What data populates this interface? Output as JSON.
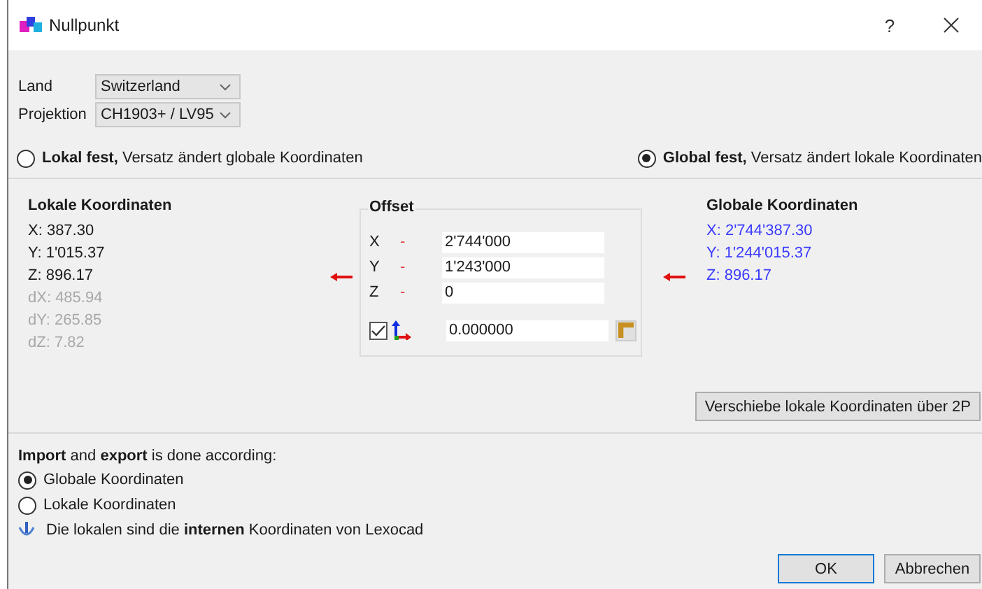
{
  "window": {
    "title": "Nullpunkt",
    "help": "?"
  },
  "land": {
    "label": "Land",
    "value": "Switzerland"
  },
  "projection": {
    "label": "Projektion",
    "value": "CH1903+ / LV95"
  },
  "mode_options": [
    {
      "label": "**Lokal fest,** Versatz ändert globale Koordinaten",
      "selected": false
    },
    {
      "label": "**Global fest,** Versatz ändert lokale Koordinaten",
      "selected": true
    }
  ],
  "local": {
    "title": "Lokale Koordinaten",
    "values": [
      "X: 387.30",
      "Y: 1'015.37",
      "Z: 896.17"
    ],
    "deltas": [
      "dX: 485.94",
      "dY: 265.85",
      "dZ: 7.82"
    ]
  },
  "offset": {
    "title": "Offset",
    "rows": [
      {
        "axis": "X",
        "sign": "-",
        "value": "2'744'000"
      },
      {
        "axis": "Y",
        "sign": "-",
        "value": "1'243'000"
      },
      {
        "axis": "Z",
        "sign": "-",
        "value": "0"
      }
    ],
    "rotation": {
      "checked": true,
      "value": "0.000000"
    }
  },
  "global": {
    "title": "Globale Koordinaten",
    "values": [
      "X: 2'744'387.30",
      "Y: 1'244'015.37",
      "Z: 896.17"
    ]
  },
  "shift_button": "Verschiebe lokale Koordinaten über 2P",
  "io": {
    "text": "**Import** and **export** is done according:",
    "options": [
      {
        "label": "Globale Koordinaten",
        "selected": true
      },
      {
        "label": "Lokale Koordinaten",
        "selected": false
      }
    ],
    "info": "Die lokalen sind die **internen** Koordinaten von Lexocad"
  },
  "buttons": [
    "OK",
    "Abbrechen"
  ]
}
